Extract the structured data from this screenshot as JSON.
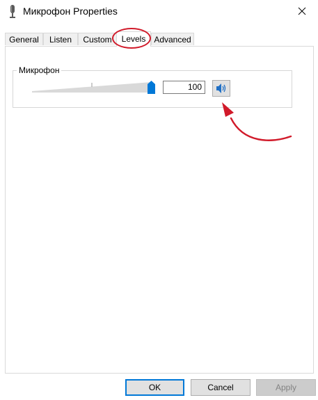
{
  "window": {
    "title": "Микрофон Properties",
    "icon": "microphone-icon",
    "close_icon": "close-icon"
  },
  "tabs": [
    {
      "label": "General",
      "active": false
    },
    {
      "label": "Listen",
      "active": false
    },
    {
      "label": "Custom",
      "active": false
    },
    {
      "label": "Levels",
      "active": true
    },
    {
      "label": "Advanced",
      "active": false
    }
  ],
  "levels": {
    "device_label": "Микрофон",
    "level_value": "100",
    "slider_fraction": 1.0,
    "mute_icon": "speaker-icon"
  },
  "annotation": {
    "color": "#d11a2a"
  },
  "buttons": {
    "ok": "OK",
    "cancel": "Cancel",
    "apply": "Apply"
  }
}
